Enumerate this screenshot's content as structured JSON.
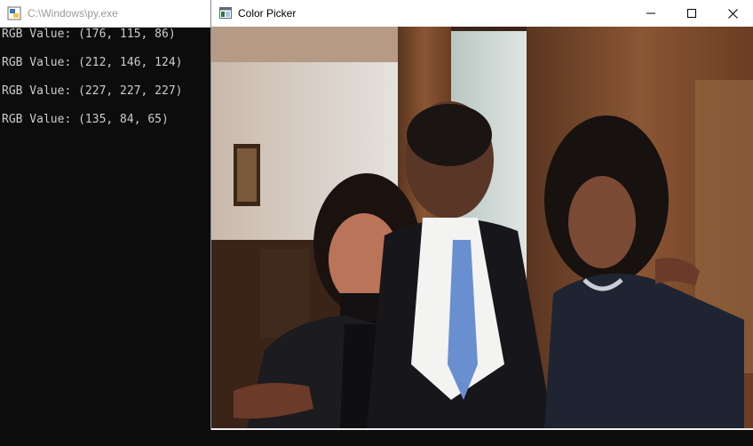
{
  "console": {
    "title": "C:\\Windows\\py.exe",
    "lines": [
      "RGB Value: (176, 115, 86)",
      "RGB Value: (212, 146, 124)",
      "RGB Value: (227, 227, 227)",
      "RGB Value: (135, 84, 65)"
    ]
  },
  "picker": {
    "title": "Color Picker",
    "controls": [
      "minimize",
      "maximize",
      "close"
    ],
    "image": {
      "description_icon": "photo-of-three-people",
      "colors": {
        "wall": "#d8d4cf",
        "wood": "#7a4a2e",
        "suit": "#1a1a1e",
        "tie": "#6a8fd0"
      }
    }
  },
  "colors": {
    "console_bg": "#0c0c0c",
    "console_text": "#cccccc",
    "titlebar": "#ffffff"
  }
}
